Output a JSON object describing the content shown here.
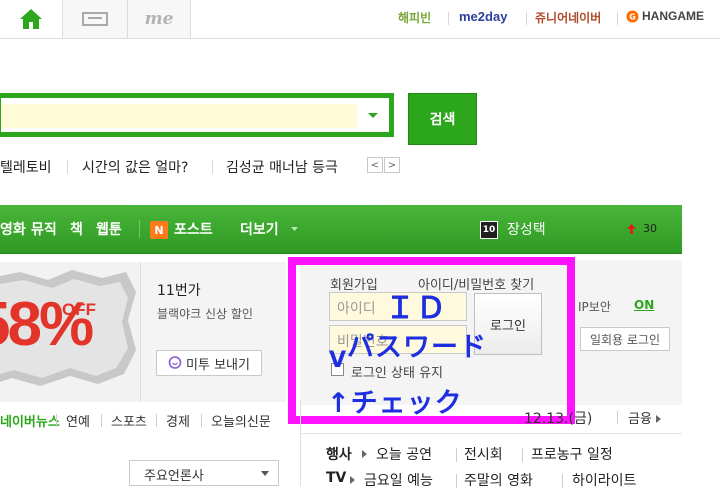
{
  "topbar": {
    "tabs": [
      {
        "icon": "home-icon"
      },
      {
        "icon": "mail-icon"
      },
      {
        "label": "me"
      }
    ],
    "services": [
      "해피빈",
      "me2day",
      "쥬니어네이버",
      "HANGAME"
    ],
    "colors": {
      "home": "#2ca71c"
    }
  },
  "search": {
    "value": "",
    "button_label": "검색",
    "accent": "#2ca71c"
  },
  "trending": {
    "items": [
      "텔레토비",
      "시간의 값은 얼마?",
      "김성균 매너남 등극"
    ],
    "prev": "<",
    "next": ">"
  },
  "nav": {
    "items": [
      "영화",
      "뮤직",
      "책",
      "웹툰"
    ],
    "post_badge": "N",
    "post_label": "포스트",
    "more_label": "더보기",
    "rank_badge": "10",
    "rank_label": "장성택",
    "rank_change": "30",
    "colors": {
      "bar": "#3aa62b"
    }
  },
  "banner": {
    "discount": "58%",
    "off": "OFF"
  },
  "promo": {
    "title": "11번가",
    "subtitle": "블랙야크 신상 할인",
    "me2_button": "미투 보내기"
  },
  "login": {
    "join": "회원가입",
    "find": "아이디/비밀번호 찾기",
    "id_placeholder": "아이디",
    "pw_placeholder": "비밀번호",
    "button": "로그인",
    "keep": "로그인 상태 유지",
    "ip_label": "IP보안",
    "ip_state": "ON",
    "onetime": "일회용 로그인"
  },
  "annotation": {
    "id": "ＩＤ",
    "pw": "パスワード",
    "v": "V",
    "check": "↑チェック",
    "color": "#ff12ff"
  },
  "date": "12.13.(금)",
  "finance": "금융",
  "news_tabs": [
    "네이버뉴스",
    "연예",
    "스포츠",
    "경제",
    "오늘의신문"
  ],
  "press_select": "주요언론사",
  "lists": {
    "row1_head": "행사",
    "row1": [
      "오늘 공연",
      "전시회",
      "프로농구 일정"
    ],
    "row2_head": "TV",
    "row2": [
      "금요일 예능",
      "주말의 영화",
      "하이라이트"
    ]
  }
}
